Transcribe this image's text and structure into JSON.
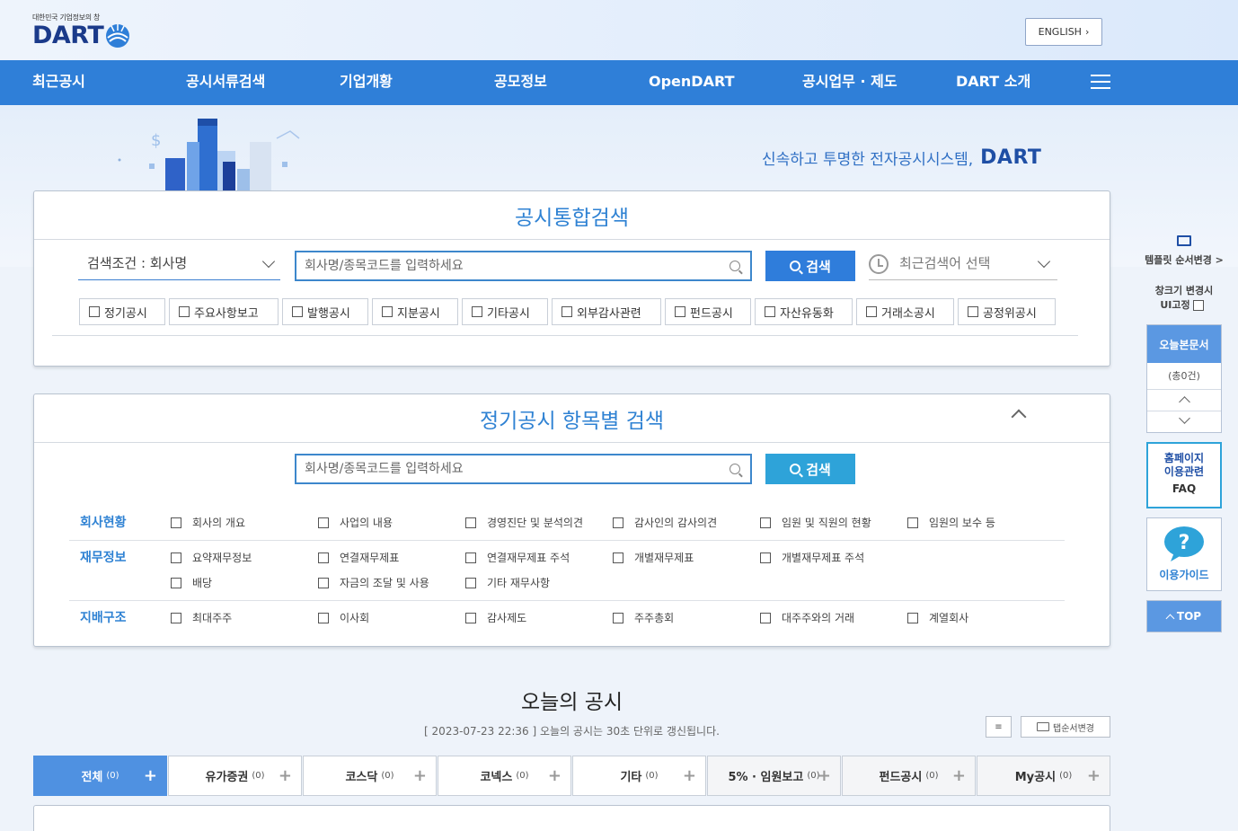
{
  "header": {
    "logo_small": "대한민국 기업정보의 창",
    "logo_main": "DART",
    "english_button": "ENGLISH"
  },
  "nav": {
    "items": [
      "최근공시",
      "공시서류검색",
      "기업개황",
      "공모정보",
      "OpenDART",
      "공시업무 · 제도",
      "DART 소개"
    ]
  },
  "hero": {
    "slogan": "신속하고 투명한 전자공시시스템,",
    "slogan_brand": "DART"
  },
  "integrated_search": {
    "title": "공시통합검색",
    "condition": "검색조건 : 회사명",
    "placeholder": "회사명/종목코드를 입력하세요",
    "search_button": "검색",
    "recent_search": "최근검색어 선택",
    "filters": [
      "정기공시",
      "주요사항보고",
      "발행공시",
      "지분공시",
      "기타공시",
      "외부감사관련",
      "펀드공시",
      "자산유동화",
      "거래소공시",
      "공정위공시"
    ]
  },
  "item_search": {
    "title": "정기공시 항목별 검색",
    "placeholder": "회사명/종목코드를 입력하세요",
    "search_button": "검색",
    "rows": [
      {
        "label": "회사현황",
        "items": [
          "회사의 개요",
          "사업의 내용",
          "경영진단 및 분석의견",
          "감사인의 감사의견",
          "임원 및 직원의 현황",
          "임원의 보수 등"
        ]
      },
      {
        "label": "재무정보",
        "items": [
          "요약재무정보",
          "연결재무제표",
          "연결재무제표 주석",
          "개별재무제표",
          "개별재무제표 주석",
          "배당",
          "자금의 조달 및 사용",
          "기타 재무사항"
        ]
      },
      {
        "label": "지배구조",
        "items": [
          "최대주주",
          "이사회",
          "감사제도",
          "주주총회",
          "대주주와의 거래",
          "계열회사"
        ]
      }
    ]
  },
  "today": {
    "title": "오늘의 공시",
    "subtitle": "[ 2023-07-23 22:36 ] 오늘의 공시는 30초 단위로 갱신됩니다.",
    "tab_order_button": "탭순서변경",
    "tabs": [
      {
        "label": "전체",
        "count": "(0)"
      },
      {
        "label": "유가증권",
        "count": "(0)"
      },
      {
        "label": "코스닥",
        "count": "(0)"
      },
      {
        "label": "코넥스",
        "count": "(0)"
      },
      {
        "label": "기타",
        "count": "(0)"
      },
      {
        "label": "5% · 임원보고",
        "count": "(0)"
      },
      {
        "label": "펀드공시",
        "count": "(0)"
      },
      {
        "label": "My공시",
        "count": "(0)"
      }
    ]
  },
  "side": {
    "template_order": "템플릿 순서변경 >",
    "window_change_1": "창크기 변경시",
    "window_change_2": "UI고정",
    "today_docs": "오늘본문서",
    "today_count": "(총0건)",
    "faq_1": "홈페이지",
    "faq_2": "이용관련",
    "faq_3": "FAQ",
    "guide": "이용가이드",
    "top": "TOP"
  },
  "colors": {
    "nav_blue": "#2f7fd8",
    "accent": "#2f82d3",
    "search_button": "#2f7ddb",
    "search_button_alt": "#2ea3d9"
  }
}
